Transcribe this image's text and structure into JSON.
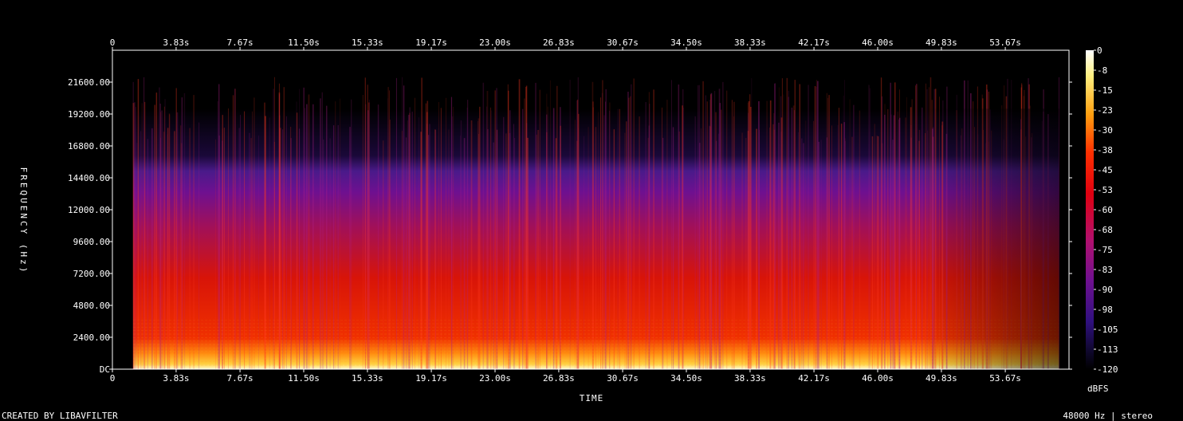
{
  "chart_data": {
    "type": "heatmap",
    "xlabel": "TIME",
    "ylabel": "FREQUENCY (Hz)",
    "x_ticks": [
      "0",
      "3.83s",
      "7.67s",
      "11.50s",
      "15.33s",
      "19.17s",
      "23.00s",
      "26.83s",
      "30.67s",
      "34.50s",
      "38.33s",
      "42.17s",
      "46.00s",
      "49.83s",
      "53.67s"
    ],
    "x_tick_values": [
      0,
      3.83,
      7.67,
      11.5,
      15.33,
      19.17,
      23.0,
      26.83,
      30.67,
      34.5,
      38.33,
      42.17,
      46.0,
      49.83,
      53.67
    ],
    "xlim": [
      0,
      57.5
    ],
    "y_ticks": [
      "DC",
      "2400.00",
      "4800.00",
      "7200.00",
      "9600.00",
      "12000.00",
      "14400.00",
      "16800.00",
      "19200.00",
      "21600.00"
    ],
    "y_tick_values": [
      0,
      2400,
      4800,
      7200,
      9600,
      12000,
      14400,
      16800,
      19200,
      21600
    ],
    "ylim": [
      0,
      24000
    ],
    "colorbar": {
      "label": "dBFS",
      "ticks": [
        "0",
        "-8",
        "-15",
        "-23",
        "-30",
        "-38",
        "-45",
        "-53",
        "-60",
        "-68",
        "-75",
        "-83",
        "-90",
        "-98",
        "-105",
        "-113",
        "-120"
      ],
      "range": [
        -120,
        0
      ]
    },
    "audio_start_s": 1.25,
    "audio_end_s": 56.9
  },
  "footer": {
    "left_text": "CREATED BY LIBAVFILTER",
    "right_text": "48000 Hz | stereo"
  }
}
